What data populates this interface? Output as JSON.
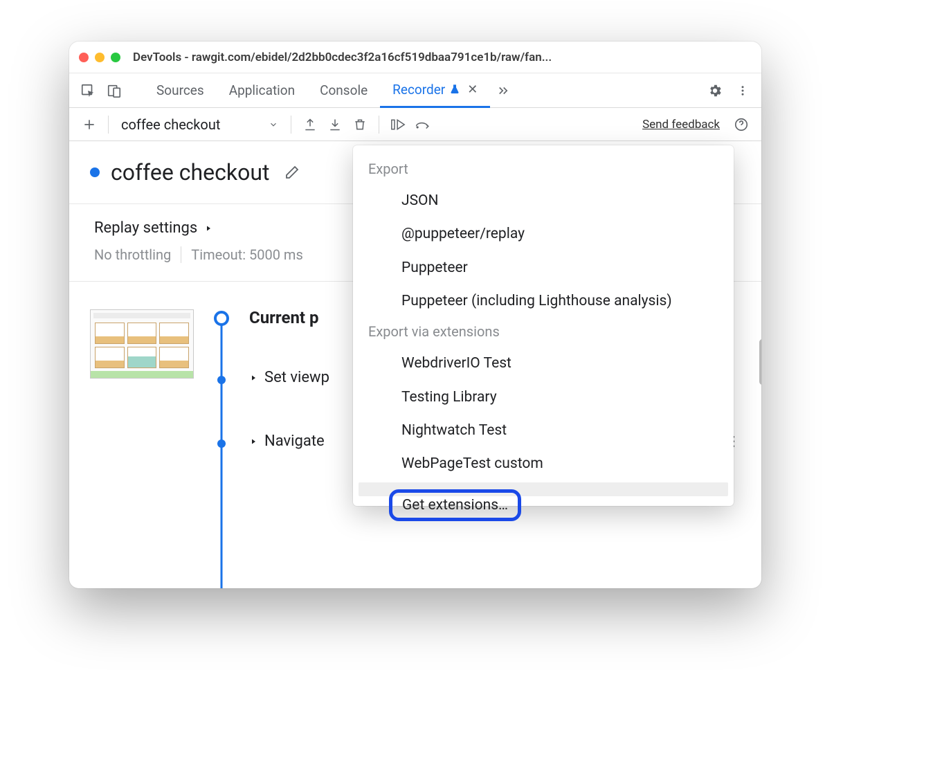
{
  "window": {
    "title": "DevTools - rawgit.com/ebidel/2d2bb0cdec3f2a16cf519dbaa791ce1b/raw/fan..."
  },
  "tabbar": {
    "tabs": [
      {
        "label": "Sources",
        "active": false
      },
      {
        "label": "Application",
        "active": false
      },
      {
        "label": "Console",
        "active": false
      },
      {
        "label": "Recorder",
        "active": true,
        "experiment": true,
        "closable": true
      }
    ]
  },
  "toolbar": {
    "recording_name": "coffee checkout",
    "send_feedback": "Send feedback"
  },
  "header": {
    "title": "coffee checkout"
  },
  "replay": {
    "heading": "Replay settings",
    "throttling": "No throttling",
    "timeout": "Timeout: 5000 ms"
  },
  "steps": {
    "current": "Current p",
    "items": [
      {
        "label": "Set viewp"
      },
      {
        "label": "Navigate"
      }
    ]
  },
  "dropdown": {
    "section1": "Export",
    "items1": [
      "JSON",
      "@puppeteer/replay",
      "Puppeteer",
      "Puppeteer (including Lighthouse analysis)"
    ],
    "section2": "Export via extensions",
    "items2": [
      "WebdriverIO Test",
      "Testing Library",
      "Nightwatch Test",
      "WebPageTest custom"
    ],
    "get_extensions": "Get extensions…"
  }
}
